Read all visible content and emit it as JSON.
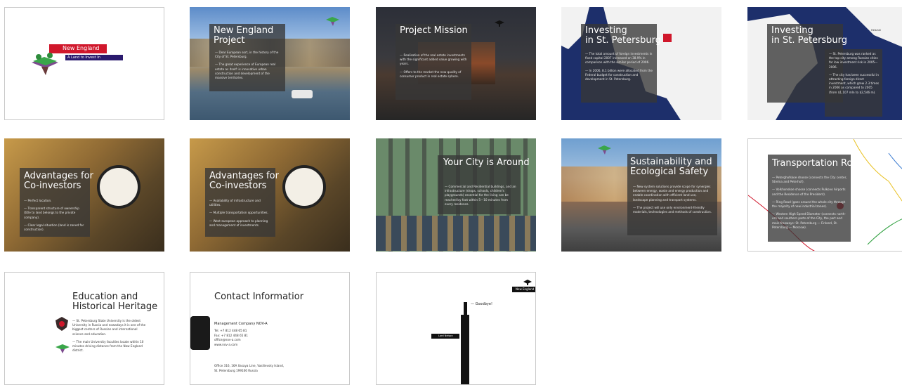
{
  "slides": {
    "s1": {
      "title": "New England",
      "subtitle": "A Land to Invest In"
    },
    "s2": {
      "title": "New England\nProject",
      "bullets": [
        "— Dear European sort, in the history of the City of St. Petersburg.",
        "— The great experience of European real estate as itself: is innovative urban construction and development of the massive territories."
      ]
    },
    "s3": {
      "title": "Project Mission",
      "bullets": [
        "— Realisation of the real estate investments with the significant added value growing with years.",
        "— Offers to the market the new quality of consumer product in real estate sphere."
      ]
    },
    "s4": {
      "title": "Investing\nin St. Petersburg",
      "bullets": [
        "— The total amount of foreign investments in fixed capital 2007 increased on 38.9% in comparison with the similar period of 2006.",
        "— In 2006, 8.1 billion were allocated from the Federal budget for construction and development in St. Petersburg."
      ]
    },
    "s5": {
      "title": "Investing\nin St. Petersburg",
      "map_label": "Helsinki",
      "bullets": [
        "— St. Petersburg was ranked as the top city among Russian cities for low investment risk in 2005—2006.",
        "— The city has been successful in attracting foreign direct investment, which grew 2.3 times in 2006 as compared to 2005 (from $1,107 mln to $2,546 m)."
      ]
    },
    "s6": {
      "title": "Advantages for\nCo-investors",
      "bullets": [
        "— Perfect location.",
        "— Transparent structure of ownership (title to land belongs to the private company).",
        "— Clear legal situation (land is zoned for construction)."
      ]
    },
    "s7": {
      "title": "Advantages for\nCo-investors",
      "bullets": [
        "— Availability of infrastructure and utilities.",
        "— Multiple transportation opportunities.",
        "— West-european approach to planning and management of investments."
      ]
    },
    "s8": {
      "title": "Your City is Around",
      "bullets": [
        "— Commercial and Residential buildings, and an infrastructure (shops, schools, children's playgrounds) essential for the living can be reached by foot within 5—10 minutes from every residence."
      ]
    },
    "s9": {
      "title": "Sustainability and\nEcological Safety",
      "bullets": [
        "— New system solutions provide scope for synergies between energy, waste and energy production and enable coordination with efficient land use, landscape planning and transport systems.",
        "— The project will use only environment-friendly materials, technologies and methods of construction."
      ]
    },
    "s10": {
      "title": "Transportation Roots",
      "bullets": [
        "— Peterghofskoe shosse (connects the City center, Strelna and Peterhof).",
        "— Volkhonskoe shosse (connects Pulkovo Airports and the Residence of the President).",
        "— Ring Road (goes around the whole city through the majority of new industrial zones).",
        "— Western High Speed Diameter (connects north-ern and southern parts of the City, the port and main freeways: St. Petersburg — Finland, St. Petersburg — Moscow)."
      ]
    },
    "s11": {
      "title": "Education and\nHistorical Heritage",
      "bullets": [
        "— St. Petersburg State University is the oldest University in Russia and nowadays it is one of the biggest centers of Russian and international science and education.",
        "— The main University faculties locate within 10 minutes driving distance from the New England district."
      ]
    },
    "s12": {
      "title": "Contact Informatior",
      "company": "Management Company NOV-A",
      "lines": [
        "Tel. +7 812 448 65 81",
        "Fax: +7 812 448 65 81",
        "office@nov-a.com",
        "www.nov-a.com"
      ],
      "address": [
        "Office 316, 16A Ilasaya Line, Vasilievsky Island,",
        "St. Petersburg 199106 Russia"
      ]
    },
    "s13": {
      "goodbye": "— Goodbye!",
      "tag": "New England",
      "plaque": "Lord Nelson"
    }
  },
  "colors": {
    "accent_red": "#d0172b",
    "panel": "#3a3a3a",
    "map_blue": "#1d2f6b"
  }
}
